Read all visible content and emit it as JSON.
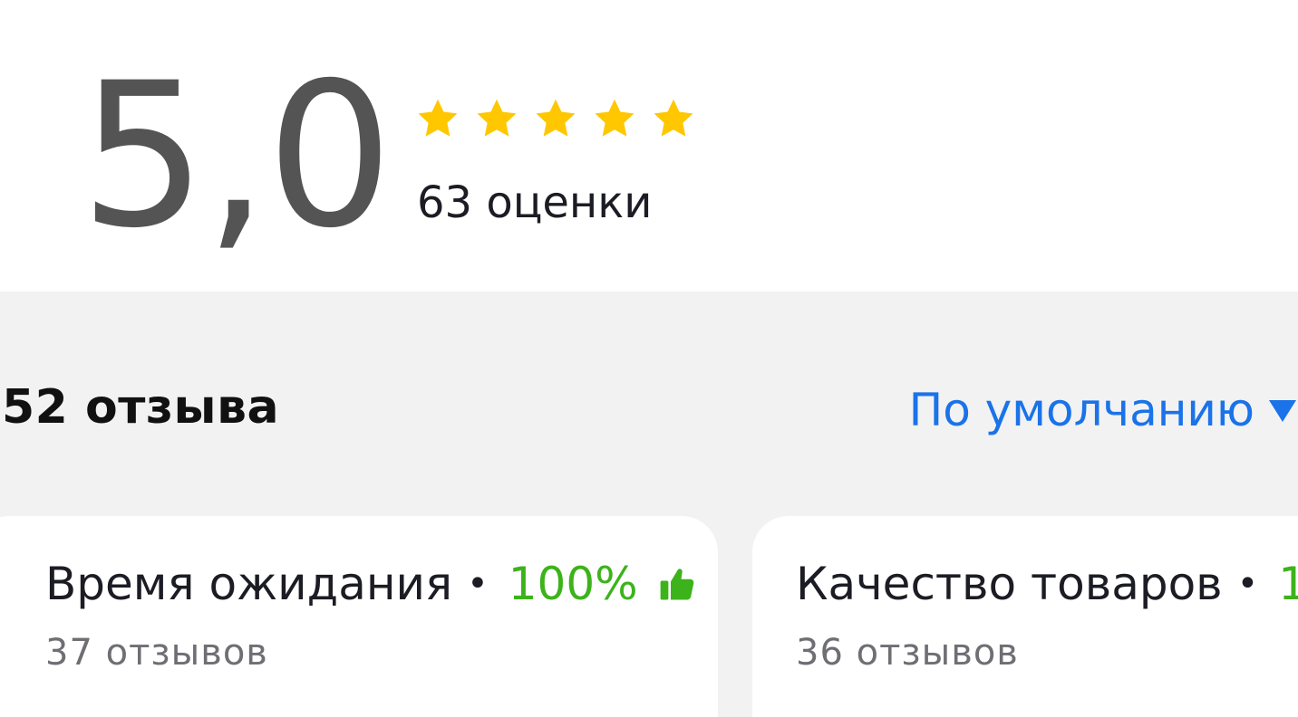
{
  "rating": {
    "score": "5,0",
    "stars_filled": 5,
    "stars_total": 5,
    "star_color": "#ffc700",
    "count_label": "63 оценки"
  },
  "reviews": {
    "title": "52 отзыва",
    "sort_label": "По умолчанию",
    "sort_icon": "triangle-down-icon",
    "accent_color": "#1a73e8"
  },
  "aspects": [
    {
      "title": "Время ожидания",
      "separator": "•",
      "percent": "100%",
      "icon": "thumbs-up-icon",
      "sub": "37 отзывов"
    },
    {
      "title": "Качество товаров",
      "separator": "•",
      "percent": "1",
      "sub": "36 отзывов"
    }
  ],
  "colors": {
    "positive": "#3db31b",
    "background": "#f2f2f3",
    "card": "#ffffff"
  }
}
